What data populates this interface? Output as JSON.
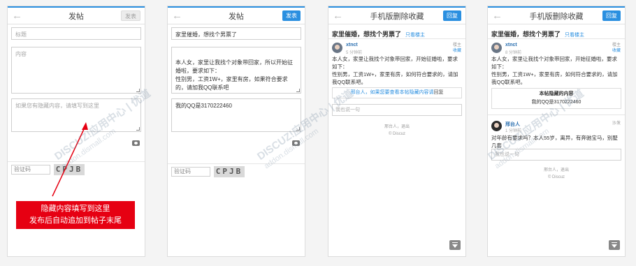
{
  "screen1": {
    "title": "发帖",
    "publish": "发表",
    "title_placeholder": "标题",
    "content_placeholder": "内容",
    "hidden_placeholder": "如果您有隐藏内容，请填写到这里",
    "captcha_placeholder": "验证码",
    "captcha_code": "CPJB",
    "callout_line1": "隐藏内容填写到这里",
    "callout_line2": "发布后自动追加到帖子末尾"
  },
  "screen2": {
    "title": "发帖",
    "publish": "发表",
    "title_value": "家里催婚，想找个男票了",
    "content_value": "本人女，家里让我找个对象带回家，所以开始征婚啦，要求如下：\n性别男，工资1W+，家里有房，如果符合要求的，请加我QQ联系吧",
    "hidden_value": "我的QQ是3170222460",
    "captcha_placeholder": "验证码",
    "captcha_code": "CPJB"
  },
  "screen3": {
    "title": "手机版删除收藏",
    "reply": "回复",
    "thread_title": "家里催婚，想找个男票了",
    "only_op": "只看楼主",
    "author": "xtnct",
    "time": "5 分钟前",
    "floor": "楼主",
    "fav": "收藏",
    "body": "本人女，家里让我找个对象带回家，开始征婚啦，要求如下：\n性别男，工资1W+，家里有房，如何符合要求的，请加我QQ联系吧。",
    "hidden_tip_link": "邢台人，如果您要查看本帖隐藏内容请",
    "hidden_tip_rest": "回复",
    "reply_placeholder": "我也说一句",
    "footer_links": "邢台人，退出",
    "footer_brand": "© Discuz"
  },
  "screen4": {
    "title": "手机版删除收藏",
    "reply": "回复",
    "thread_title": "家里催婚，想找个男票了",
    "only_op": "只看楼主",
    "author": "xtnct",
    "time": "8 分钟前",
    "floor": "楼主",
    "fav": "收藏",
    "body": "本人女，家里让我找个对象带回家，开始征婚啦，要求如下：\n性别男，工资1W+，家里有房，如何符合要求的，请加我QQ联系吧。",
    "hidden_box_title": "本帖隐藏的内容",
    "hidden_box_value": "我的QQ是3170222460",
    "reply_author": "邢台人",
    "reply_time": "1 分钟前",
    "reply_floor": "沙发",
    "reply_body": "对年龄有要求吗？本人55岁，离异，有奔驰宝马，别墅几套",
    "reply_placeholder": "我也说一句",
    "footer_links": "邢台人，退出",
    "footer_brand": "© Discuz"
  },
  "watermark": {
    "line1": "DISCUZ!应用中心 | 优道",
    "line2": "addon.dismall.com"
  },
  "colors": {
    "accent": "#2a8fe0",
    "callout": "#e60012"
  }
}
